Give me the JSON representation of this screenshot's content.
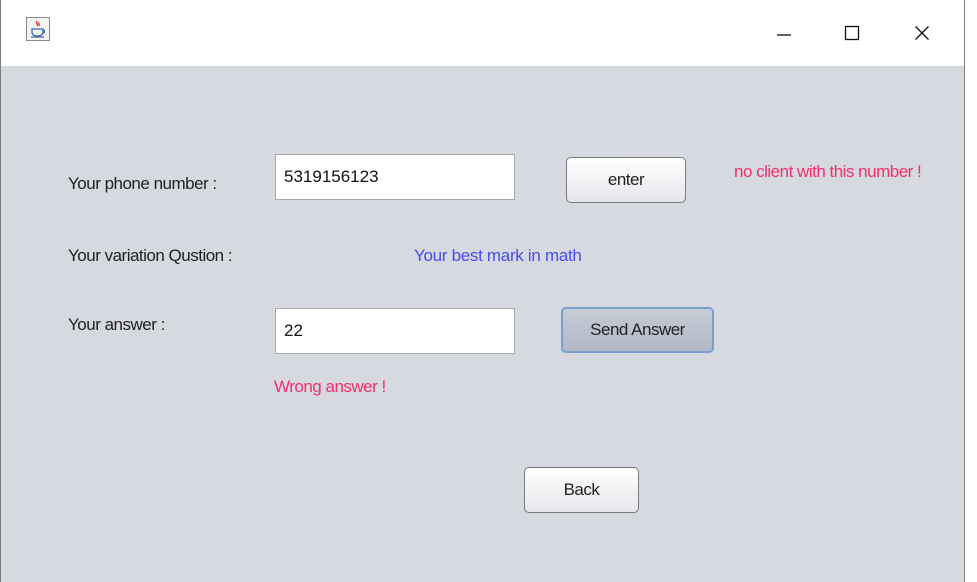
{
  "window": {
    "icon": "java-cup-icon",
    "controls": {
      "minimize": "minimize-icon",
      "maximize": "maximize-icon",
      "close": "close-icon"
    }
  },
  "form": {
    "phone_label": "Your phone number :",
    "phone_value": "5319156123",
    "enter_label": "enter",
    "phone_error": "no client with this number !",
    "question_label": "Your variation Qustion :",
    "question_value": "Your best mark in math",
    "answer_label": "Your answer :",
    "answer_value": "22",
    "send_label": "Send Answer",
    "answer_error": "Wrong answer !",
    "back_label": "Back"
  },
  "colors": {
    "error_text": "#f0306a",
    "question_text": "#4a4af0",
    "panel_bg": "#d6d9df"
  }
}
